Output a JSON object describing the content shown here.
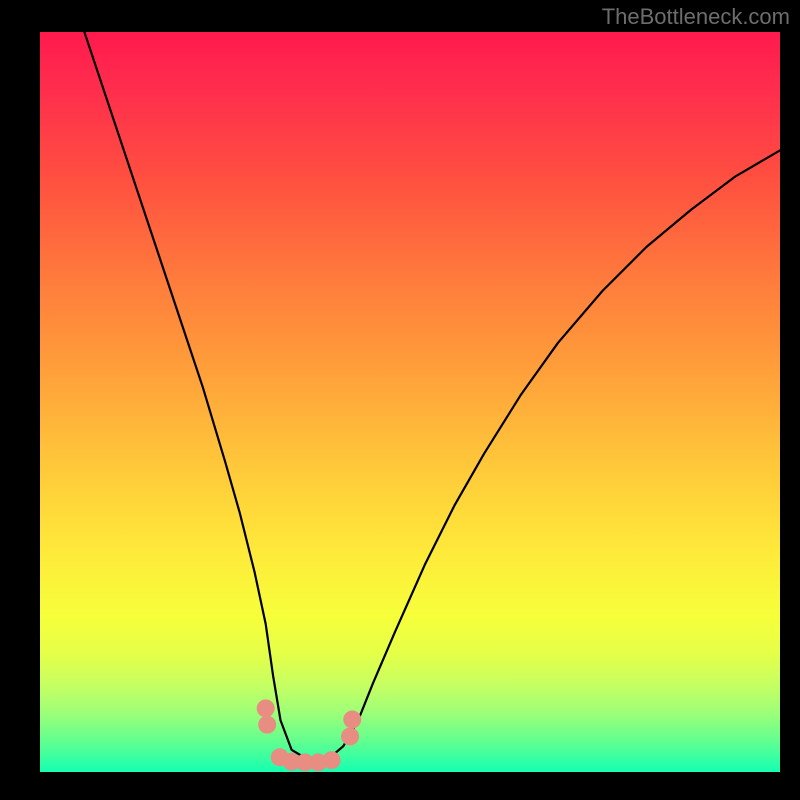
{
  "watermark": "TheBottleneck.com",
  "chart_data": {
    "type": "line",
    "title": "",
    "xlabel": "",
    "ylabel": "",
    "xlim": [
      0,
      100
    ],
    "ylim": [
      0,
      100
    ],
    "curve": {
      "name": "bottleneck-curve",
      "x": [
        6,
        10,
        14,
        18,
        22,
        25,
        27,
        29,
        30.5,
        31.5,
        32.5,
        34,
        36,
        37.5,
        39,
        41,
        43,
        45,
        48,
        52,
        56,
        60,
        65,
        70,
        76,
        82,
        88,
        94,
        100
      ],
      "y": [
        100,
        88,
        76,
        64,
        52,
        42,
        35,
        27,
        20,
        13,
        7,
        3,
        1.8,
        1.4,
        1.8,
        3.5,
        7,
        12,
        19,
        28,
        36,
        43,
        51,
        58,
        65,
        71,
        76,
        80.5,
        84
      ]
    },
    "markers": {
      "name": "highlight-points",
      "color": "#e88d82",
      "points": [
        {
          "x": 30.5,
          "y": 8.6
        },
        {
          "x": 30.7,
          "y": 6.4
        },
        {
          "x": 32.4,
          "y": 2.0
        },
        {
          "x": 34.0,
          "y": 1.4
        },
        {
          "x": 35.8,
          "y": 1.3
        },
        {
          "x": 37.6,
          "y": 1.3
        },
        {
          "x": 39.4,
          "y": 1.6
        },
        {
          "x": 41.9,
          "y": 4.8
        },
        {
          "x": 42.2,
          "y": 7.1
        }
      ]
    },
    "background_gradient": {
      "stops": [
        {
          "pct": 0,
          "color": "#ff1a4d"
        },
        {
          "pct": 50,
          "color": "#ffb43a"
        },
        {
          "pct": 80,
          "color": "#f6ff3a"
        },
        {
          "pct": 100,
          "color": "#15ffb2"
        }
      ]
    }
  }
}
